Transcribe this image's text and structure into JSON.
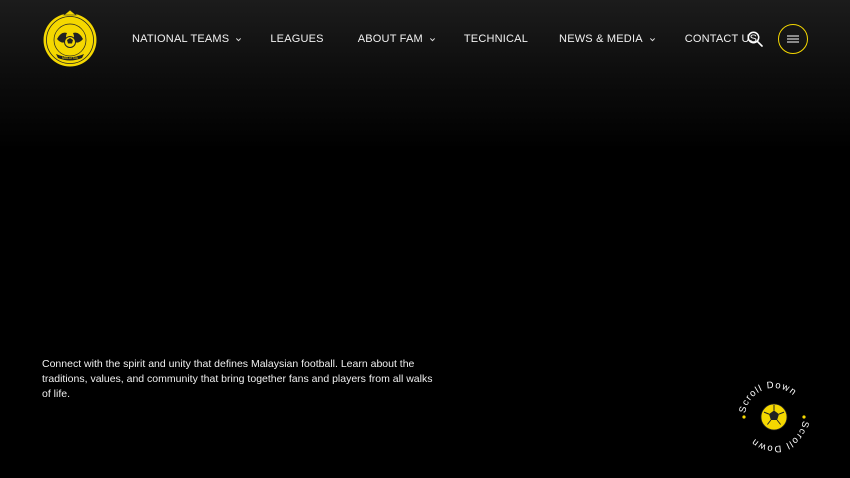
{
  "header": {
    "logo_alt": "Persatuan Bolasepak Malaysia",
    "nav": [
      {
        "label": "NATIONAL TEAMS",
        "has_dropdown": true
      },
      {
        "label": "LEAGUES",
        "has_dropdown": false
      },
      {
        "label": "ABOUT FAM",
        "has_dropdown": true
      },
      {
        "label": "TECHNICAL",
        "has_dropdown": false
      },
      {
        "label": "NEWS & MEDIA",
        "has_dropdown": true
      },
      {
        "label": "CONTACT US",
        "has_dropdown": false
      }
    ],
    "search_icon": "search-icon",
    "menu_icon": "hamburger-icon"
  },
  "hero": {
    "intro": "Connect with the spirit and unity that defines Malaysian football. Learn about the traditions, values, and community that bring together fans and players from all walks of life."
  },
  "scroll_badge": {
    "text": "Scroll Down",
    "icon": "football-icon"
  },
  "colors": {
    "accent": "#f5d800",
    "background": "#000000",
    "text": "#ffffff"
  }
}
